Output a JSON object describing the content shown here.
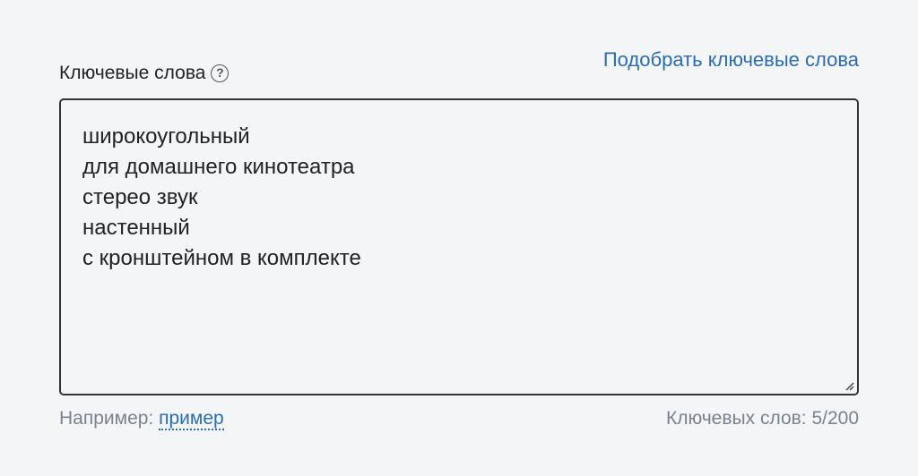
{
  "field": {
    "label": "Ключевые слова",
    "help_icon": "?",
    "suggest_link": "Подобрать ключевые слова",
    "keywords": [
      "широкоугольный",
      "для домашнего кинотеатра",
      "стерео звук",
      "настенный",
      "с кронштейном в комплекте"
    ],
    "example_prefix": "Например:",
    "example_link": "пример",
    "counter": "Ключевых слов: 5/200"
  },
  "colors": {
    "background": "#f4f5f7",
    "link": "#2b6cb0",
    "muted_text": "#7a8290",
    "border": "#333333"
  },
  "icons": {
    "help": "question-circle-icon",
    "resize": "resize-handle-icon"
  }
}
